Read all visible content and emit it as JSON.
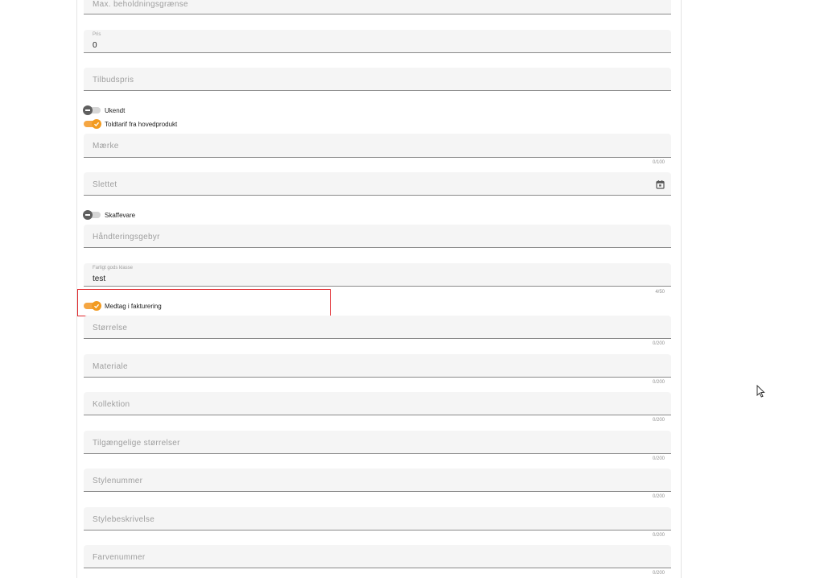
{
  "fields": {
    "max_beholdning": {
      "placeholder": "Max. beholdningsgrænse"
    },
    "pris": {
      "label": "Pris",
      "value": "0"
    },
    "tilbudspris": {
      "placeholder": "Tilbudspris"
    },
    "maerke": {
      "placeholder": "Mærke",
      "counter": "0/100"
    },
    "slettet": {
      "placeholder": "Slettet"
    },
    "haandteringsgebyr": {
      "placeholder": "Håndteringsgebyr"
    },
    "farligt_gods": {
      "label": "Farligt gods klasse",
      "value": "test",
      "counter": "4/50"
    },
    "stoerrelse": {
      "placeholder": "Størrelse",
      "counter": "0/200"
    },
    "materiale": {
      "placeholder": "Materiale",
      "counter": "0/200"
    },
    "kollektion": {
      "placeholder": "Kollektion",
      "counter": "0/200"
    },
    "tilgaengelige": {
      "placeholder": "Tilgængelige størrelser",
      "counter": "0/200"
    },
    "stylenummer": {
      "placeholder": "Stylenummer",
      "counter": "0/200"
    },
    "stylebeskrivelse": {
      "placeholder": "Stylebeskrivelse",
      "counter": "0/200"
    },
    "farvenummer": {
      "placeholder": "Farvenummer",
      "counter": "0/200"
    }
  },
  "toggles": {
    "ukendt": {
      "label": "Ukendt",
      "checked": false
    },
    "toldtarif": {
      "label": "Toldtarif fra hovedprodukt",
      "checked": true
    },
    "skaffevare": {
      "label": "Skaffevare",
      "checked": false
    },
    "medtag": {
      "label": "Medtag i fakturering",
      "checked": true
    }
  },
  "icons": {
    "calendar": "calendar-icon",
    "check": "check-icon",
    "cursor": "mouse-pointer-icon"
  },
  "colors": {
    "accent": "#f29b21",
    "highlight": "#e0262b",
    "field_bg": "#f5f5f5"
  }
}
